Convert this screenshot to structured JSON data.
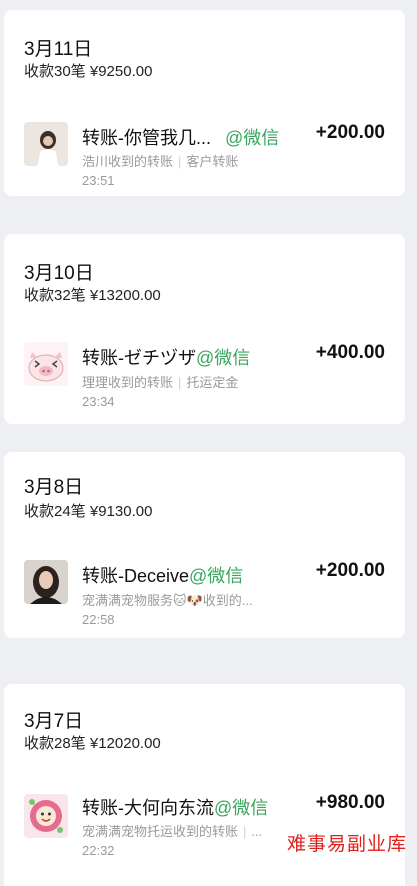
{
  "days": [
    {
      "date": "3月11日",
      "summary": "收款30笔 ¥9250.00",
      "tx": {
        "title": "转账-你管我几...",
        "source": "@微信",
        "amount": "+200.00",
        "payer": "浩川收到的转账",
        "note": "客户转账",
        "time": "23:51",
        "avatar_icon": "girl-photo-avatar"
      }
    },
    {
      "date": "3月10日",
      "summary": "收款32笔 ¥13200.00",
      "tx": {
        "title": "转账-ゼチヅザ",
        "source": "@微信",
        "amount": "+400.00",
        "payer": "理理收到的转账",
        "note": "托运定金",
        "time": "23:34",
        "avatar_icon": "cartoon-pig-avatar"
      }
    },
    {
      "date": "3月8日",
      "summary": "收款24笔 ¥9130.00",
      "tx": {
        "title": "转账-Deceive",
        "source": "@微信",
        "amount": "+200.00",
        "payer": "宠满满宠物服务🐱🐶收到的...",
        "note": "",
        "time": "22:58",
        "avatar_icon": "woman-portrait-avatar"
      }
    },
    {
      "date": "3月7日",
      "summary": "收款28笔 ¥12020.00",
      "tx": {
        "title": "转账-大何向东流",
        "source": "@微信",
        "amount": "+980.00",
        "payer": "宠满满宠物托运收到的转账",
        "note": "...",
        "time": "22:32",
        "avatar_icon": "cartoon-flower-avatar"
      }
    }
  ],
  "watermark": "难事易副业库",
  "colors": {
    "source_green": "#3aa55c",
    "watermark_red": "#e0201b",
    "background": "#eeeff3"
  }
}
